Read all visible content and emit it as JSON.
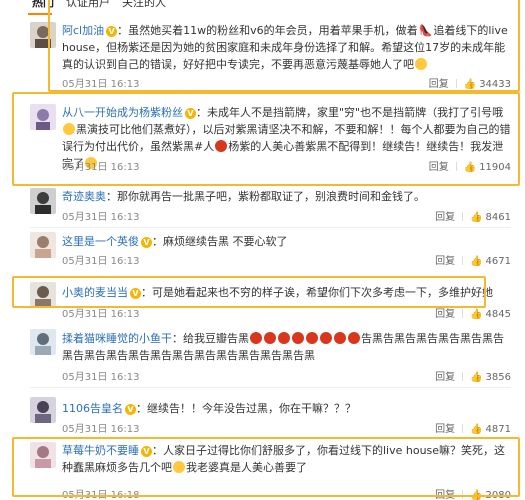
{
  "tabs": [
    {
      "label": "热门"
    },
    {
      "label": "认证用户"
    },
    {
      "label": "关注的人"
    }
  ],
  "reply_label": "回复",
  "colors": {
    "accent": "#ff8200",
    "highlight": "#f5b82e",
    "link": "#2b6fba"
  },
  "comments": [
    {
      "user": "阿cl加油",
      "text_before": "：虽然她买着11w的粉丝和v6的年会员，用着苹果手机，做着",
      "emoji1": "shoe-icon",
      "text_mid": "追着线下的live house，但杨紫还是因为她的贫困家庭和未成年身份选择了和解。希望这位17岁的未成年能真的认识到自己的错误，好好把中专读完，不要再恶意污蔑基辱她人了吧",
      "emoji2": "pray-icon",
      "date": "05月31日 16:13",
      "likes": "34433",
      "verified": true
    },
    {
      "user": "从八一开始成为杨紫粉丝",
      "text_before": "：未成年人不是挡箭牌，家里\"穷\"也不是挡箭牌（我打了引号哦",
      "emoji1": "smile-icon",
      "text_mid": "黑演技可比他们蒸煮好），以后对紫黑请坚决不和解，不要和解！！每个人都要为自己的错误行为付出代价，虽然紫黑#人",
      "emoji2": "angry-icon",
      "text_after": "杨紫的人美心善紫黑不配得到！继续告！继续告！我发泄完了",
      "emoji3": "smile-icon",
      "date": "05月31日 16:13",
      "likes": "11904",
      "verified": true
    },
    {
      "user": "奇迹奥奥",
      "text": "：那你就再告一批黑子吧，紫粉都取证了，别浪费时间和金钱了。",
      "date": "05月31日 16:13",
      "likes": "8461"
    },
    {
      "user": "这里是一个英俊",
      "text": "：麻烦继续告黑 不要心软了",
      "date": "05月31日 16:13",
      "likes": "4671"
    },
    {
      "user": "小奥的麦当当",
      "text": "：可是她看起来也不穷的样子诶，希望你们下次多考虑一下，多维护好她",
      "date": "05月31日 16:13",
      "likes": "4845",
      "verified": true
    },
    {
      "user": "揉着猫咪睡觉的小鱼干",
      "text_before": "：给我豆瓣告黑",
      "emoji_run": "angry-icon",
      "text_mid": "告黑告黑告黑告黑告黑告黑告黑告黑告黑告黑告黑告黑告黑告黑告黑告黑告黑告黑",
      "date": "05月31日 16:13",
      "likes": "3856"
    },
    {
      "user": "1106告皇名",
      "text": "：继续告！！今年没告过黑，你在干嘛？？？",
      "date": "05月31日 16:13",
      "likes": "4871",
      "verified": true
    },
    {
      "user": "草莓牛奶不要睡",
      "text_before": "：人家日子过得比你们舒服多了，你看过线下的live house嘛？笑死，这种蠢黑麻烦多告几个吧",
      "emoji1": "thumbs-icon",
      "text_mid": "我老婆真是人美心善要了",
      "date": "05月31日 16:18",
      "likes": "2080",
      "verified": true
    }
  ]
}
